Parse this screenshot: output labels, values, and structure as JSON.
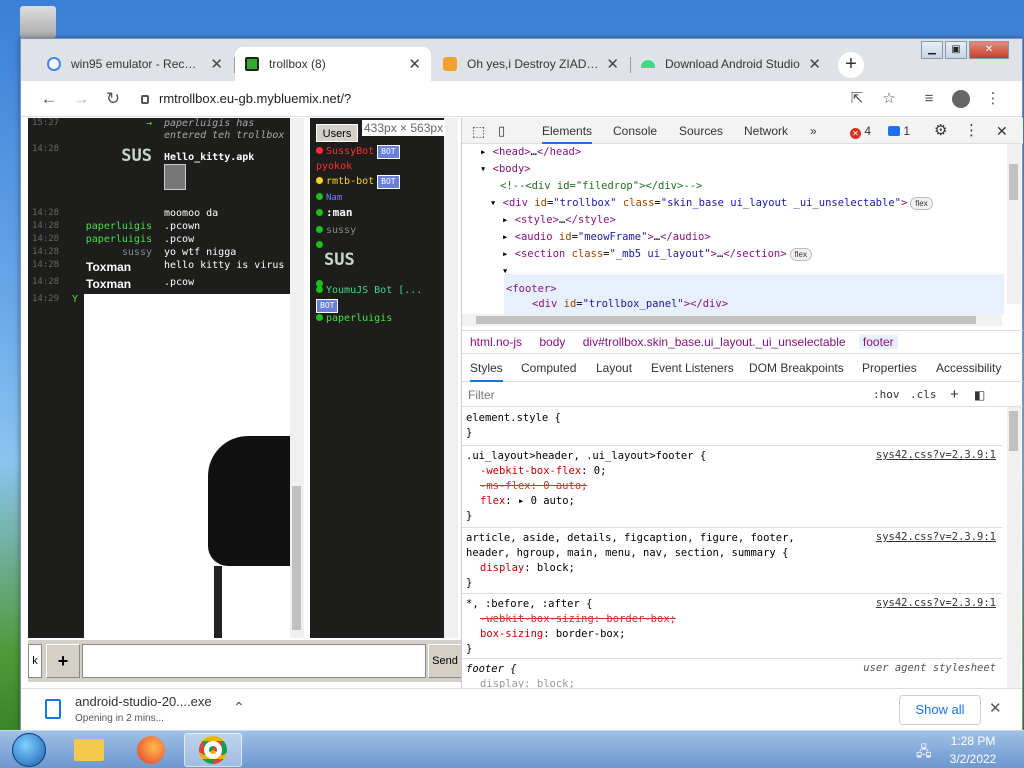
{
  "browser": {
    "tabs": [
      {
        "title": "win95 emulator - Recherche Google",
        "icon": "google-icon",
        "color": "#4285f4"
      },
      {
        "title": "trollbox (8)",
        "icon": "trollbox-icon",
        "color": "#222"
      },
      {
        "title": "Oh yes,i Destroy ZIAD,yes",
        "icon": "bitcoin-icon",
        "color": "#f0a030"
      },
      {
        "title": "Download Android Studio",
        "icon": "android-icon",
        "color": "#3ddc84"
      }
    ],
    "new_tab": "+",
    "url": "rmtrollbox.eu-gb.mybluemix.net/?"
  },
  "chat": {
    "messages": [
      {
        "time": "15:27",
        "user": "→",
        "user_color": "#4ce04c",
        "text": "paperluigis has",
        "text2": "entered teh trollbox",
        "italic": true
      },
      {
        "time": "14:28",
        "user": "SUS",
        "user_color": "#c8d8c8",
        "text": "Hello_kitty.apk",
        "big": true
      },
      {
        "time": "14:28",
        "user": "",
        "user_color": "#888",
        "text": "moomoo da"
      },
      {
        "time": "14:28",
        "user": "paperluigis",
        "user_color": "#4ce04c",
        "text": ".pcown"
      },
      {
        "time": "14:28",
        "user": "paperluigis",
        "user_color": "#4ce04c",
        "text": ".pcow"
      },
      {
        "time": "14:28",
        "user": "sussy",
        "user_color": "#888",
        "text": "yo wtf nigga"
      },
      {
        "time": "14:28",
        "user": "Toxman",
        "user_color": "#fff",
        "text": "hello kitty is virus",
        "bold": true
      },
      {
        "time": "14:28",
        "user": "Toxman",
        "user_color": "#fff",
        "text": ".pcow",
        "bold": true
      },
      {
        "time": "14:29",
        "user": "Y",
        "user_color": "#4ce04c",
        "text": ""
      }
    ],
    "input_prefix": "k",
    "add_label": "+",
    "send_label": "Send"
  },
  "users": {
    "header": "Users",
    "dims": "433px × 563px",
    "list": [
      {
        "name": "SussyBot",
        "color": "#ff3030",
        "dot": "#ff3030",
        "bot": "BOT"
      },
      {
        "name": "pyokok",
        "color": "#ff3030",
        "dot": ""
      },
      {
        "name": "rmtb-bot",
        "color": "#ffd21f",
        "dot": "#ffd21f",
        "bot": "BOT"
      },
      {
        "name": "Nam",
        "color": "#6a7fff",
        "dot": "#1fbf1f"
      },
      {
        "name": ":man",
        "color": "#fff",
        "dot": "#1fbf1f"
      },
      {
        "name": "sussy",
        "color": "#888",
        "dot": "#1fbf1f"
      },
      {
        "name": "",
        "color": "#888",
        "dot": "#1fbf1f"
      },
      {
        "name": "SUS",
        "color": "#c8d8c8",
        "dot": ""
      },
      {
        "name": "YoumuJS Bot [...",
        "color": "#3ddc84",
        "dot": "#1fbf1f",
        "bot": "BOT"
      },
      {
        "name": "paperluigis",
        "color": "#4ce04c",
        "dot": "#1fbf1f"
      }
    ]
  },
  "devtools": {
    "tabs": [
      "Elements",
      "Console",
      "Sources",
      "Network",
      "»"
    ],
    "errors": "4",
    "messages": "1",
    "breadcrumbs": [
      "html.no-js",
      "body",
      "div#trollbox.skin_base.ui_layout._ui_unselectable",
      "footer"
    ],
    "style_tabs": [
      "Styles",
      "Computed",
      "Layout",
      "Event Listeners",
      "DOM Breakpoints",
      "Properties",
      "Accessibility"
    ],
    "filter_placeholder": "Filter",
    "hov": ":hov",
    "cls": ".cls",
    "source": "sys42.css?v=2.3.9:1",
    "ua": "user agent stylesheet"
  },
  "download": {
    "file": "android-studio-20....exe",
    "status": "Opening in 2 mins...",
    "show_all": "Show all"
  },
  "taskbar": {
    "time": "1:28 PM",
    "date": "3/2/2022"
  }
}
